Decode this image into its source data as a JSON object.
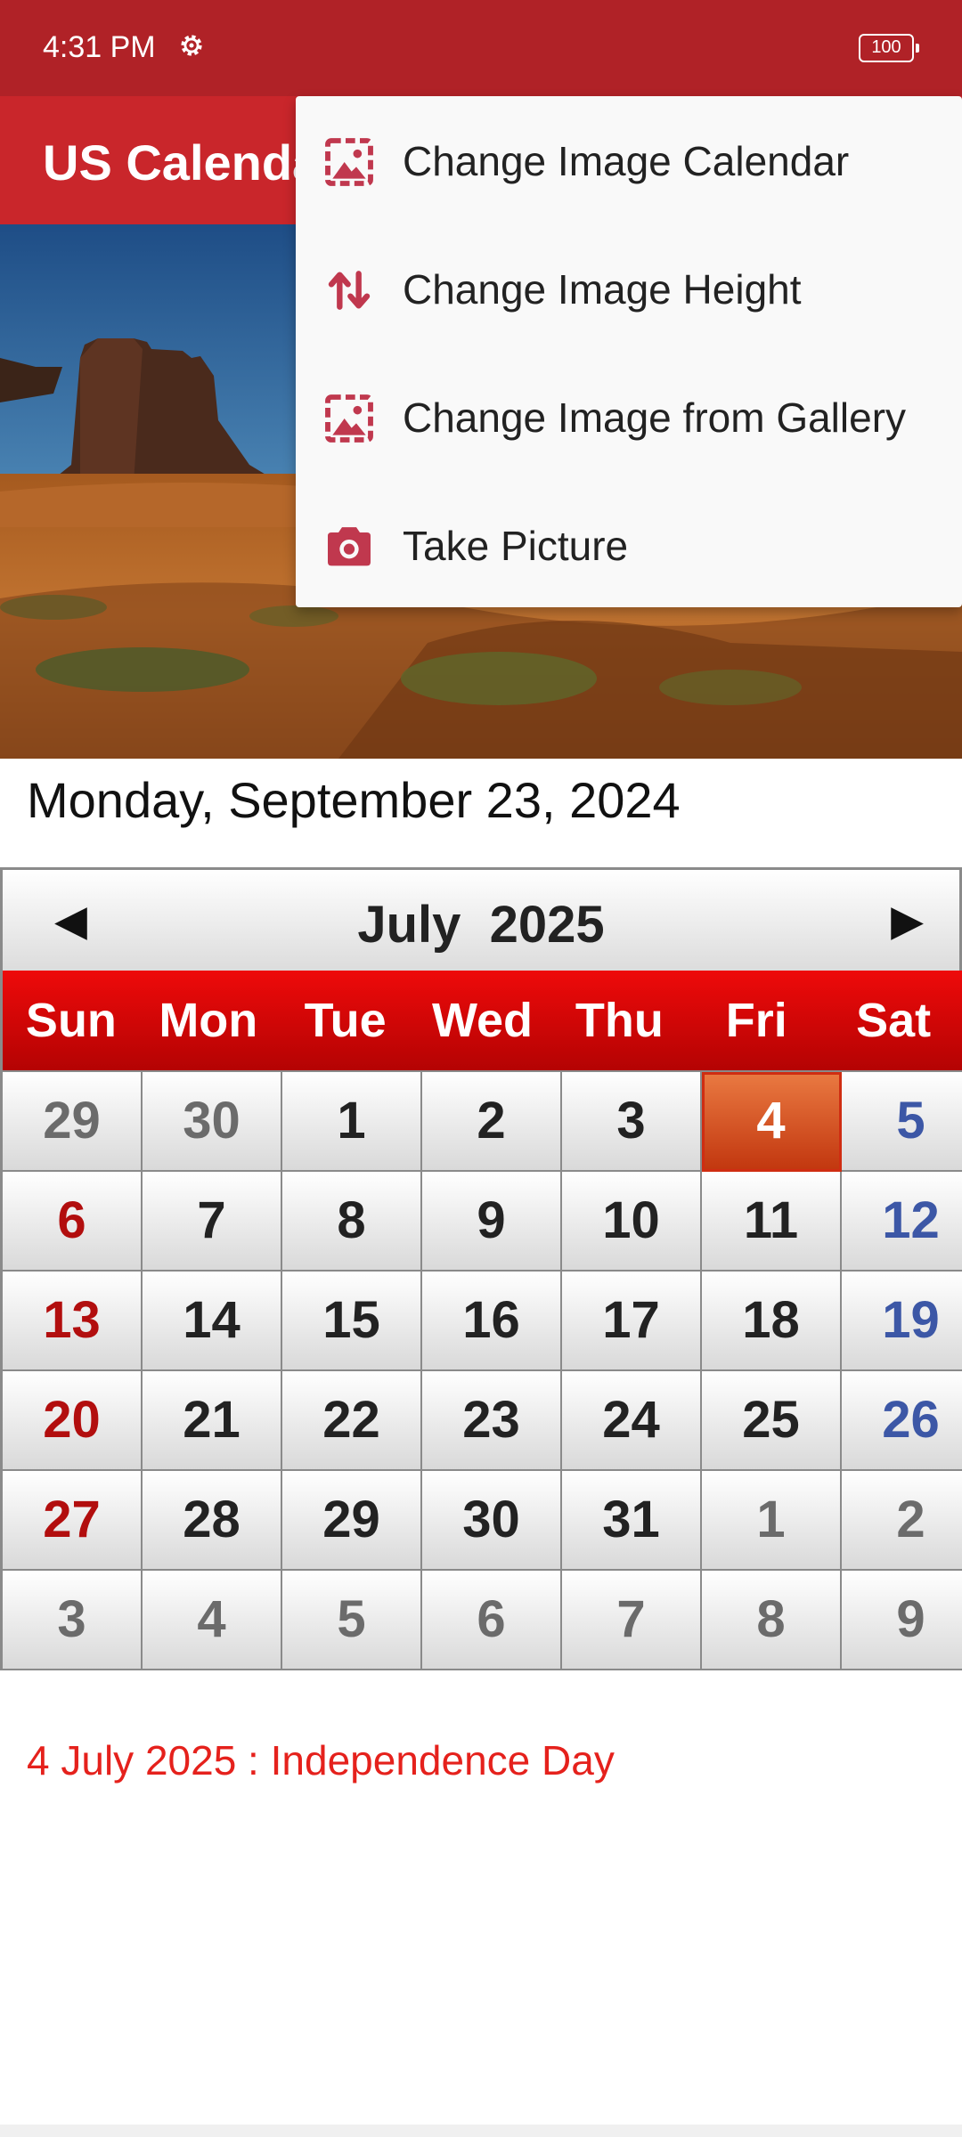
{
  "status_bar": {
    "time": "4:31 PM",
    "battery": "100"
  },
  "app_bar": {
    "title": "US Calendar"
  },
  "current_date": "Monday, September 23, 2024",
  "calendar": {
    "prev_arrow": "◀",
    "next_arrow": "▶",
    "month_label": "July  2025",
    "weekdays": [
      "Sun",
      "Mon",
      "Tue",
      "Wed",
      "Thu",
      "Fri",
      "Sat"
    ],
    "days": [
      {
        "label": "29",
        "type": "other"
      },
      {
        "label": "30",
        "type": "other"
      },
      {
        "label": "1",
        "type": "cur"
      },
      {
        "label": "2",
        "type": "cur"
      },
      {
        "label": "3",
        "type": "cur"
      },
      {
        "label": "4",
        "type": "holiday"
      },
      {
        "label": "5",
        "type": "sat"
      },
      {
        "label": "6",
        "type": "sun"
      },
      {
        "label": "7",
        "type": "cur"
      },
      {
        "label": "8",
        "type": "cur"
      },
      {
        "label": "9",
        "type": "cur"
      },
      {
        "label": "10",
        "type": "cur"
      },
      {
        "label": "11",
        "type": "cur"
      },
      {
        "label": "12",
        "type": "sat"
      },
      {
        "label": "13",
        "type": "sun"
      },
      {
        "label": "14",
        "type": "cur"
      },
      {
        "label": "15",
        "type": "cur"
      },
      {
        "label": "16",
        "type": "cur"
      },
      {
        "label": "17",
        "type": "cur"
      },
      {
        "label": "18",
        "type": "cur"
      },
      {
        "label": "19",
        "type": "sat"
      },
      {
        "label": "20",
        "type": "sun"
      },
      {
        "label": "21",
        "type": "cur"
      },
      {
        "label": "22",
        "type": "cur"
      },
      {
        "label": "23",
        "type": "cur"
      },
      {
        "label": "24",
        "type": "cur"
      },
      {
        "label": "25",
        "type": "cur"
      },
      {
        "label": "26",
        "type": "sat"
      },
      {
        "label": "27",
        "type": "sun"
      },
      {
        "label": "28",
        "type": "cur"
      },
      {
        "label": "29",
        "type": "cur"
      },
      {
        "label": "30",
        "type": "cur"
      },
      {
        "label": "31",
        "type": "cur"
      },
      {
        "label": "1",
        "type": "other"
      },
      {
        "label": "2",
        "type": "other"
      },
      {
        "label": "3",
        "type": "other"
      },
      {
        "label": "4",
        "type": "other"
      },
      {
        "label": "5",
        "type": "other"
      },
      {
        "label": "6",
        "type": "other"
      },
      {
        "label": "7",
        "type": "other"
      },
      {
        "label": "8",
        "type": "other"
      },
      {
        "label": "9",
        "type": "other"
      }
    ]
  },
  "holiday_note": "4 July 2025 : Independence Day",
  "menu": {
    "items": [
      {
        "label": "Change Image Calendar",
        "icon": "image-icon"
      },
      {
        "label": "Change Image Height",
        "icon": "swap-vertical-icon"
      },
      {
        "label": "Change Image from Gallery",
        "icon": "gallery-icon"
      },
      {
        "label": "Take Picture",
        "icon": "camera-icon"
      }
    ]
  },
  "colors": {
    "status_bar": "#b02227",
    "app_bar": "#c9262b",
    "weekday_header": "#d10606",
    "holiday_cell": "#d9531f",
    "sunday_text": "#b20e0e",
    "saturday_text": "#3c57a6",
    "holiday_text": "#e5211c",
    "menu_icon": "#c0384e"
  }
}
